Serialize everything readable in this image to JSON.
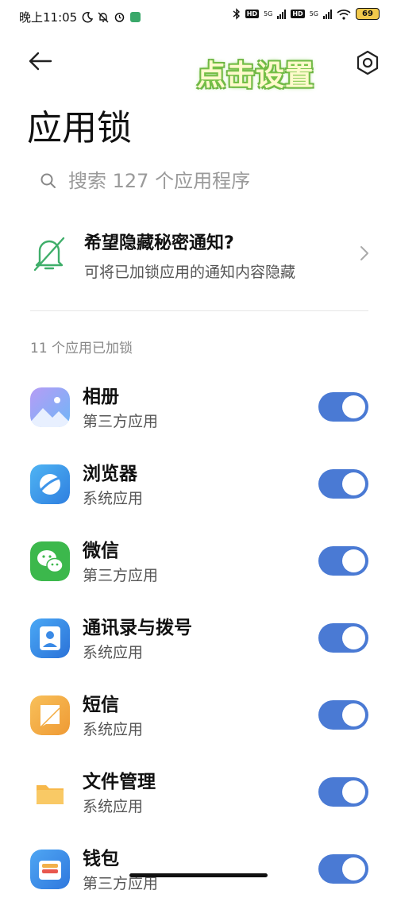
{
  "status_bar": {
    "time": "晚上11:05",
    "network_tag_1": "HD",
    "network_gen_1": "5G",
    "network_tag_2": "HD",
    "network_gen_2": "5G",
    "battery": "69"
  },
  "header": {
    "title": "应用锁",
    "overlay_label": "点击设置"
  },
  "search": {
    "placeholder": "搜索 127 个应用程序"
  },
  "notice": {
    "title": "希望隐藏秘密通知?",
    "subtitle": "可将已加锁应用的通知内容隐藏"
  },
  "section": {
    "title": "11 个应用已加锁"
  },
  "apps": [
    {
      "name": "相册",
      "type": "第三方应用",
      "icon": "gallery-icon",
      "enabled": true
    },
    {
      "name": "浏览器",
      "type": "系统应用",
      "icon": "browser-icon",
      "enabled": true
    },
    {
      "name": "微信",
      "type": "第三方应用",
      "icon": "wechat-icon",
      "enabled": true
    },
    {
      "name": "通讯录与拨号",
      "type": "系统应用",
      "icon": "contacts-icon",
      "enabled": true
    },
    {
      "name": "短信",
      "type": "系统应用",
      "icon": "messages-icon",
      "enabled": true
    },
    {
      "name": "文件管理",
      "type": "系统应用",
      "icon": "file-manager-icon",
      "enabled": true
    },
    {
      "name": "钱包",
      "type": "第三方应用",
      "icon": "wallet-icon",
      "enabled": true
    }
  ],
  "colors": {
    "toggle_on": "#4a7ad4",
    "notice_icon": "#3fae6a"
  }
}
